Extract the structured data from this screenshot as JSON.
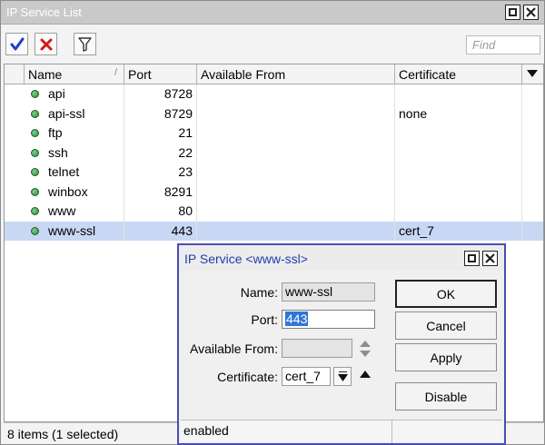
{
  "window": {
    "title": "IP Service List"
  },
  "toolbar": {
    "enable_icon": "checkmark-icon",
    "disable_icon": "x-icon",
    "filter_icon": "funnel-icon",
    "find_placeholder": "Find"
  },
  "columns": [
    "Name",
    "Port",
    "Available From",
    "Certificate"
  ],
  "rows": [
    {
      "name": "api",
      "port": "8728",
      "available_from": "",
      "certificate": ""
    },
    {
      "name": "api-ssl",
      "port": "8729",
      "available_from": "",
      "certificate": "none"
    },
    {
      "name": "ftp",
      "port": "21",
      "available_from": "",
      "certificate": ""
    },
    {
      "name": "ssh",
      "port": "22",
      "available_from": "",
      "certificate": ""
    },
    {
      "name": "telnet",
      "port": "23",
      "available_from": "",
      "certificate": ""
    },
    {
      "name": "winbox",
      "port": "8291",
      "available_from": "",
      "certificate": ""
    },
    {
      "name": "www",
      "port": "80",
      "available_from": "",
      "certificate": ""
    },
    {
      "name": "www-ssl",
      "port": "443",
      "available_from": "",
      "certificate": "cert_7",
      "selected": true
    }
  ],
  "status": {
    "summary": "8 items (1 selected)"
  },
  "dialog": {
    "title": "IP Service <www-ssl>",
    "name_label": "Name:",
    "name_value": "www-ssl",
    "port_label": "Port:",
    "port_value": "443",
    "available_from_label": "Available From:",
    "available_from_value": "",
    "certificate_label": "Certificate:",
    "certificate_value": "cert_7",
    "buttons": {
      "ok": "OK",
      "cancel": "Cancel",
      "apply": "Apply",
      "disable": "Disable"
    },
    "status": "enabled"
  },
  "colors": {
    "title_bar": "#c9c9c9",
    "selected_row": "#c8d8f4",
    "dialog_border": "#4b4bb4",
    "enabled_dot": "#2b8a3e",
    "enable_check": "#1f3ec9",
    "disable_x": "#d11a1a"
  }
}
